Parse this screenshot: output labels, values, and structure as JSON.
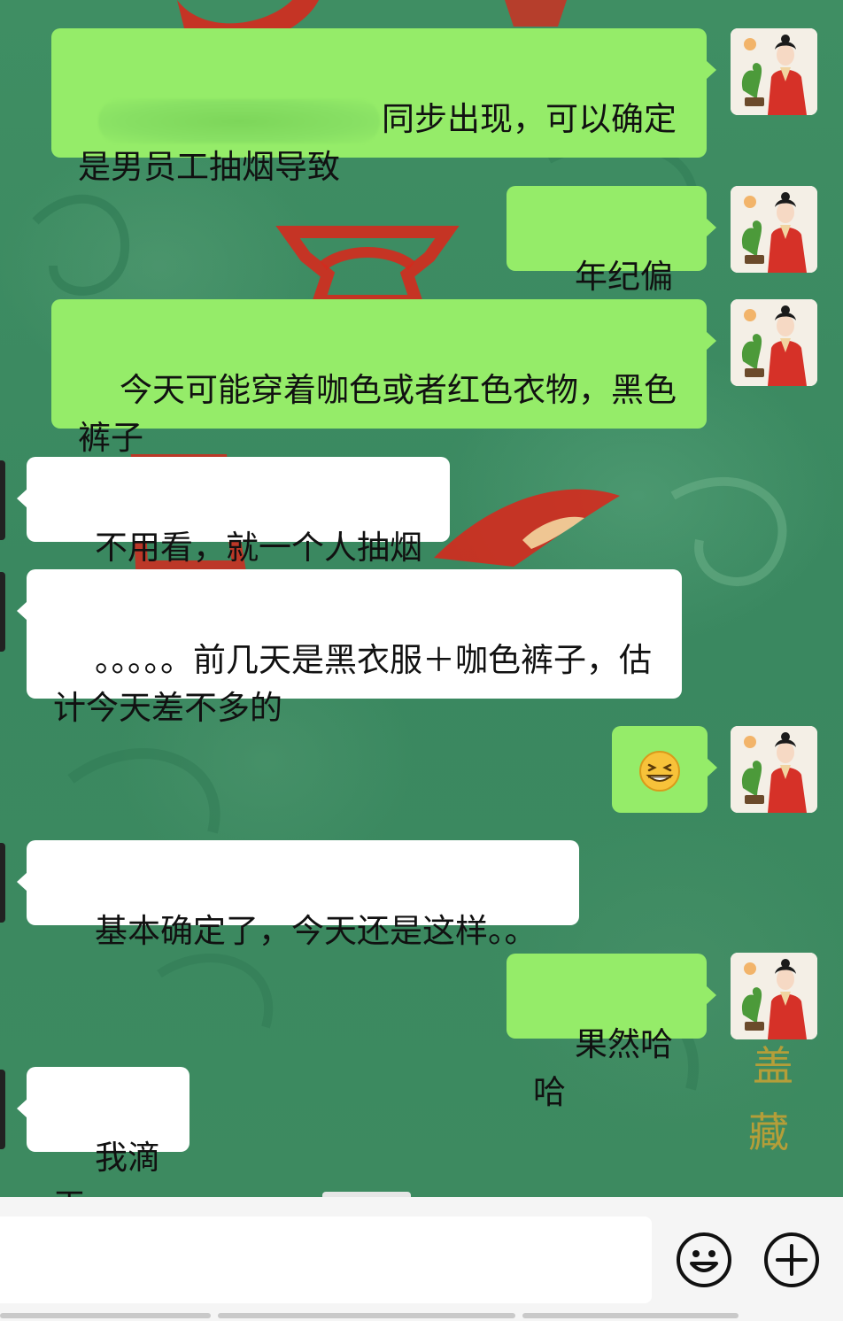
{
  "chat": {
    "messages": [
      {
        "direction": "out",
        "text": "同步出现，可以确定是男员工抽烟导致",
        "redacted_prefix": true
      },
      {
        "direction": "out",
        "text": "年纪偏大"
      },
      {
        "direction": "out",
        "text": "今天可能穿着咖色或者红色衣物，黑色裤子"
      },
      {
        "direction": "in",
        "text": "不用看，就一个人抽烟"
      },
      {
        "direction": "in",
        "text": "。。。。。前几天是黑衣服＋咖色裤子，估计今天差不多的"
      },
      {
        "direction": "out",
        "emoji": "grinning-squint-emoji"
      },
      {
        "direction": "in",
        "text": "基本确定了，今天还是这样。。"
      },
      {
        "direction": "out",
        "text": "果然哈哈"
      },
      {
        "direction": "in",
        "text": "我滴天"
      }
    ]
  },
  "input_bar": {
    "placeholder": "",
    "value": "",
    "icons": [
      "emoji-face-icon",
      "plus-circle-icon"
    ]
  },
  "colors": {
    "outgoing_bubble": "#95ec69",
    "incoming_bubble": "#ffffff",
    "background": "#3e8c62",
    "input_bar": "#f5f5f5"
  }
}
